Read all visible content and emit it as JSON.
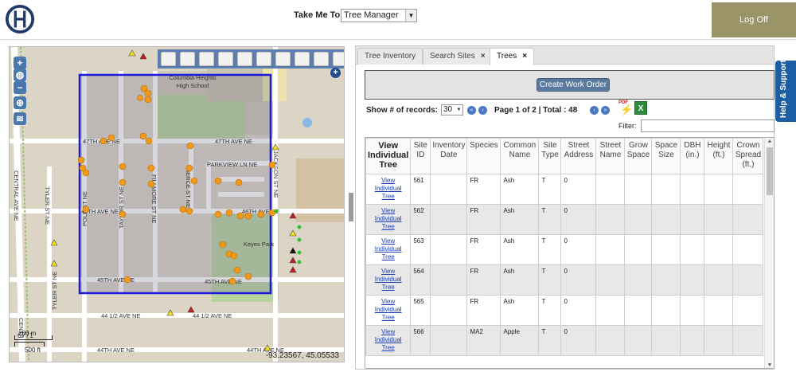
{
  "header": {
    "take_me_label": "Take Me To:",
    "take_me_value": "Tree Manager",
    "logoff_label": "Log Off"
  },
  "map": {
    "coordinates": "-93.23567, 45.05533",
    "scale_top": "200 m",
    "scale_bottom": "500 ft",
    "partial_label": "6771",
    "selection_color": "#1a1adb",
    "labels": {
      "school": "Columbia Heights\nHigh School",
      "park": "Keyes Park",
      "ave47": "47TH AVE NE",
      "ave47b": "47TH AVE NE",
      "ave46": "46TH AVE NE",
      "ave46b": "46TH AVE NE",
      "ave45": "45TH AVE NE",
      "ave45b": "45TH AVE NE",
      "ave44h": "44 1/2 AVE NE",
      "ave44hb": "44 1/2 AVE NE",
      "ave44": "44TH AVE NE",
      "ave44b": "44TH AVE NE",
      "parkview": "PARKVIEW LN NE",
      "polk": "POLK ST NE",
      "taylor": "TAYLOR ST NE",
      "fillmore": "FILLMORE ST NE",
      "pierce": "PIERCE ST NE",
      "jackson": "JACKSON ST NE",
      "central": "CENTRAL AVE NE",
      "centralb": "CENTR",
      "tyler": "TYLER ST NE",
      "tylerb": "TYLER ST NE"
    }
  },
  "tabs": [
    {
      "label": "Tree Inventory",
      "closable": false,
      "active": false
    },
    {
      "label": "Search Sites",
      "closable": true,
      "active": false
    },
    {
      "label": "Trees",
      "closable": true,
      "active": true
    }
  ],
  "work_order_button": "Create Work Order",
  "records": {
    "label": "Show # of records:",
    "value": "30",
    "page_info": "Page 1 of 2 | Total : 48",
    "filter_label": "Filter:"
  },
  "icons": {
    "pdf": "PDF",
    "xls": "X"
  },
  "table": {
    "columns": [
      "View Individual Tree",
      "Site ID",
      "Inventory Date",
      "Species",
      "Common Name",
      "Site Type",
      "Street Address",
      "Street Name",
      "Grow Space",
      "Space Size",
      "DBH (in.)",
      "Height (ft.)",
      "Crown Spread (ft.)"
    ],
    "rows": [
      {
        "link": "View Individual Tree",
        "site_id": "561",
        "inventory_date": "",
        "species": "FR",
        "common_name": "Ash",
        "site_type": "T",
        "street_address": "0"
      },
      {
        "link": "View Individual Tree",
        "site_id": "562",
        "inventory_date": "",
        "species": "FR",
        "common_name": "Ash",
        "site_type": "T",
        "street_address": "0"
      },
      {
        "link": "View Individual Tree",
        "site_id": "563",
        "inventory_date": "",
        "species": "FR",
        "common_name": "Ash",
        "site_type": "T",
        "street_address": "0"
      },
      {
        "link": "View Individual Tree",
        "site_id": "564",
        "inventory_date": "",
        "species": "FR",
        "common_name": "Ash",
        "site_type": "T",
        "street_address": "0"
      },
      {
        "link": "View Individual Tree",
        "site_id": "565",
        "inventory_date": "",
        "species": "FR",
        "common_name": "Ash",
        "site_type": "T",
        "street_address": "0"
      },
      {
        "link": "View Individual Tree",
        "site_id": "566",
        "inventory_date": "",
        "species": "MA2",
        "common_name": "Apple",
        "site_type": "T",
        "street_address": "0"
      }
    ]
  },
  "help_tab": "Help & Support"
}
